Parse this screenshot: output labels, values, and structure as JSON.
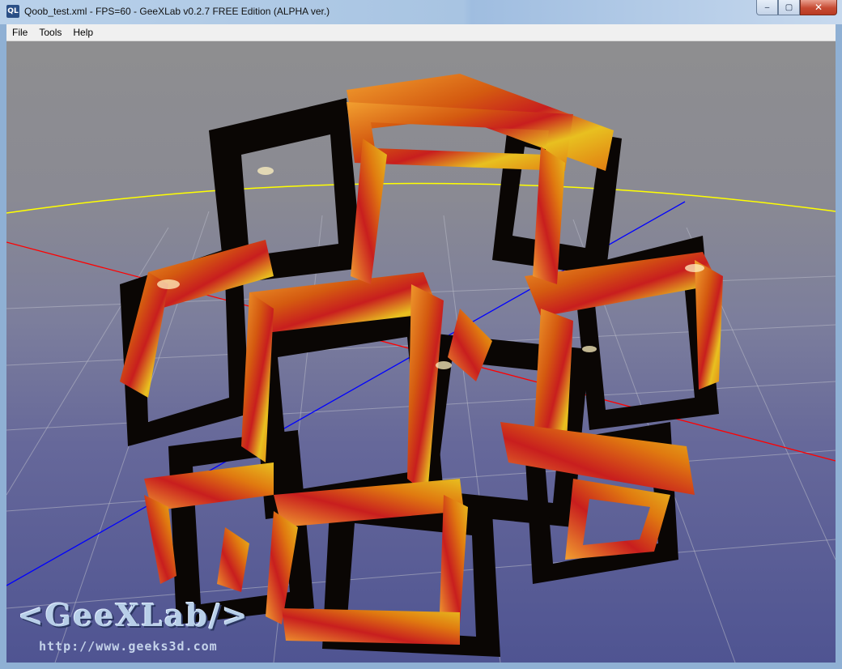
{
  "window": {
    "title": "Qoob_test.xml - FPS=60 - GeeXLab v0.2.7 FREE Edition (ALPHA ver.)",
    "app_icon_text": "QL",
    "controls": {
      "minimize": "‒",
      "maximize": "▢",
      "close": "✕"
    }
  },
  "menu": {
    "file": "File",
    "tools": "Tools",
    "help": "Help"
  },
  "viewport": {
    "logo_text": "<GeeXLab/>",
    "logo_url": "http://www.geeks3d.com"
  },
  "colors": {
    "axis_x": "#ff0000",
    "axis_y": "#ffff00",
    "axis_z": "#0000ff",
    "grid": "#b9bcc8",
    "mesh_orange": "#e07a10",
    "mesh_red": "#c81e1e",
    "mesh_yellow": "#e8c020",
    "mesh_dark": "#0a0604"
  }
}
